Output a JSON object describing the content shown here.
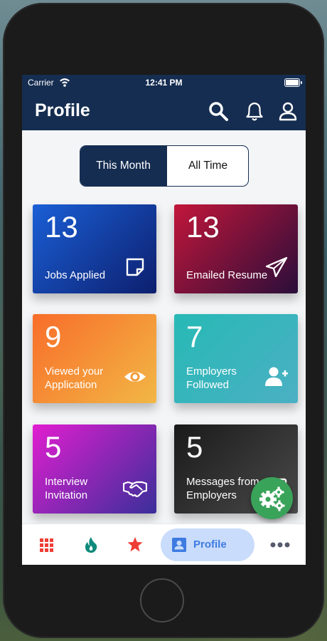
{
  "status_bar": {
    "carrier": "Carrier",
    "time": "12:41 PM"
  },
  "header": {
    "title": "Profile",
    "icons": [
      "search-icon",
      "bell-icon",
      "user-icon"
    ]
  },
  "segment": {
    "options": [
      "This Month",
      "All Time"
    ],
    "selected": "This Month"
  },
  "cards": [
    {
      "value": "13",
      "label": "Jobs Applied",
      "icon": "note-icon",
      "colors": [
        "#1a5fd6",
        "#0d1f6e"
      ]
    },
    {
      "value": "13",
      "label": "Emailed Resume",
      "icon": "paper-plane-icon",
      "colors": [
        "#c2163a",
        "#2a0e3a"
      ]
    },
    {
      "value": "9",
      "label": "Viewed your Application",
      "icon": "eye-icon",
      "colors": [
        "#f86d2a",
        "#f2b745"
      ]
    },
    {
      "value": "7",
      "label": "Employers Followed",
      "icon": "user-plus-icon",
      "colors": [
        "#27b9b5",
        "#4bb0c4"
      ]
    },
    {
      "value": "5",
      "label": "Interview Invitation",
      "icon": "handshake-icon",
      "colors": [
        "#e11ed0",
        "#3a2f9a"
      ]
    },
    {
      "value": "5",
      "label": "Messages from Employers",
      "icon": "message-icon",
      "colors": [
        "#1a1a1a",
        "#4a4a4a"
      ]
    }
  ],
  "bottom_nav": {
    "items": [
      {
        "icon": "grid-icon",
        "color": "#ef3e36"
      },
      {
        "icon": "flame-icon",
        "color": "#0f8a7c"
      },
      {
        "icon": "star-icon",
        "color": "#ef3e36"
      },
      {
        "icon": "profile-icon",
        "label": "Profile",
        "active": true,
        "color": "#3d7be0"
      },
      {
        "icon": "more-icon",
        "color": "#555a6e"
      }
    ]
  },
  "fab": {
    "icon": "gears-icon",
    "color": "#3aa35a"
  },
  "colors": {
    "header": "#152d51",
    "accent": "#3d7be0"
  }
}
